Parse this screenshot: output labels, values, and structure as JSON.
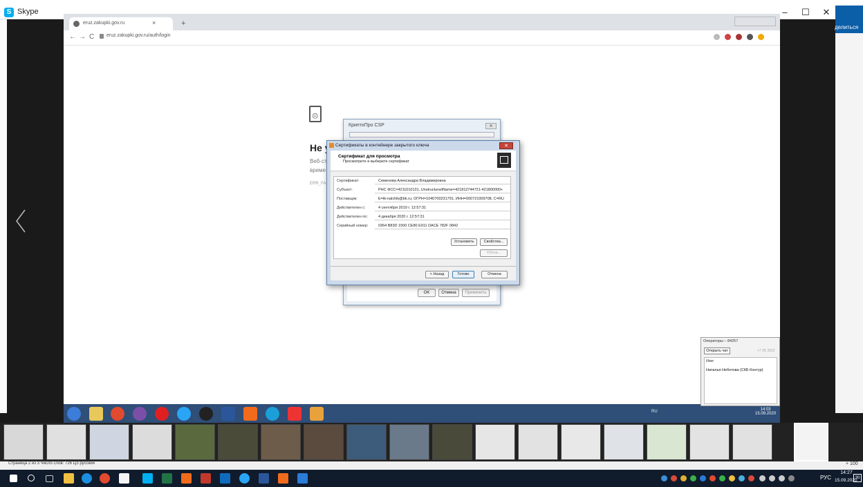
{
  "skype": {
    "app_name": "Skype",
    "share_label": "делиться",
    "minimize": "–",
    "maximize": "☐",
    "close": "✕"
  },
  "browser": {
    "tab_title": "eruz.zakupki.gov.ru",
    "tab_close": "×",
    "new_tab": "+",
    "back": "←",
    "forward": "→",
    "reload": "C",
    "address": "eruz.zakupki.gov.ru/auth/login"
  },
  "error_page": {
    "heading": "Не у",
    "line1": "Веб-ст",
    "line2": "време",
    "code": "ERR_FAIL"
  },
  "cryptopro": {
    "title": "КриптоПро CSP",
    "close": "✕",
    "buttons": [
      "OK",
      "Отмена",
      "Применить"
    ]
  },
  "cert_dialog": {
    "title": "Сертификаты в контейнере закрытого ключа",
    "close": "✕",
    "header_title": "Сертификат для просмотра",
    "header_subtitle": "Просмотрите и выберите сертификат",
    "fields": [
      {
        "label": "Сертификат:",
        "value": "Семенова Александра Владимировна"
      },
      {
        "label": "Субъект:",
        "value": "РНС ФСС=4211010131, UnstructuredName=421812744721-421800000+"
      },
      {
        "label": "Поставщик:",
        "value": "E=ib-nalchik@bk.ru, ОГРН=1040700231791, ИНН=000721009708, C=RU"
      },
      {
        "label": "Действителен с:",
        "value": "4 сентября 2019 г. 12:57:31"
      },
      {
        "label": "Действителен по:",
        "value": "4 декабря 2020 г. 12:57:31"
      },
      {
        "label": "Серийный номер:",
        "value": "0364 B83D 1500 CE80 E911 DACE 782F 0842"
      }
    ],
    "install_button": "Установить",
    "properties_button": "Свойства...",
    "browse_button": "Обзор...",
    "back_button": "< Назад",
    "done_button": "Готово",
    "cancel_button": "Отмена"
  },
  "operators": {
    "title": "Операторы – 84257",
    "open_chat": "Открыть чат",
    "phone": "+7 (8) 3502",
    "column": "Имя",
    "row": "Наталья Неботова (СКБ Контур)"
  },
  "remote_tray": {
    "lang": "RU",
    "time": "14:03",
    "date": "15.09.2020"
  },
  "word_status": {
    "text": "Страница 2 из 3    Число слов: 726    ЦЗ    русский",
    "zoom": "+ 100"
  },
  "taskbar": {
    "lang": "РУС",
    "time": "14:27",
    "date": "15.09.2020",
    "notifications": "30"
  },
  "colors": {
    "skype_blue": "#00aff0",
    "remote_taskbar": "#2f4e78",
    "windows_taskbar": "#101b2c",
    "dialog_border": "#5b7fa6"
  }
}
